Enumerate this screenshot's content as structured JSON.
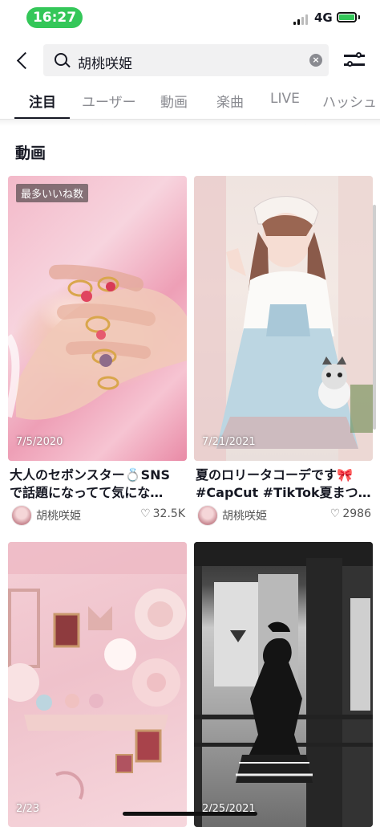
{
  "status_bar": {
    "time": "16:27",
    "network": "4G"
  },
  "search": {
    "query": "胡桃咲姫",
    "clear_label": "×"
  },
  "tabs": [
    {
      "label": "注目"
    },
    {
      "label": "ユーザー"
    },
    {
      "label": "動画"
    },
    {
      "label": "楽曲"
    },
    {
      "label": "LIVE"
    },
    {
      "label": "ハッシュ"
    }
  ],
  "active_tab": "注目",
  "section_title": "動画",
  "videos": [
    {
      "badge": "最多いいね数",
      "date": "7/5/2020",
      "caption_line1": "大人のセボンスター💍SNS",
      "caption_line2": "で話題になってて気にな…",
      "author": "胡桃咲姫",
      "likes": "32.5K"
    },
    {
      "badge": "",
      "date": "7/21/2021",
      "caption_line1": "夏のロリータコーデです🎀",
      "caption_line2": "#CapCut #TikTok夏まつり…",
      "author": "胡桃咲姫",
      "likes": "2986"
    },
    {
      "badge": "",
      "date": "2/23",
      "caption_line1": "",
      "caption_line2": "",
      "author": "",
      "likes": ""
    },
    {
      "badge": "",
      "date": "2/25/2021",
      "caption_line1": "",
      "caption_line2": "",
      "author": "",
      "likes": ""
    }
  ],
  "icons": {
    "back": "chevron-left-icon",
    "search": "search-icon",
    "clear": "clear-icon",
    "filter": "filter-sliders-icon",
    "heart": "heart-outline-icon"
  },
  "colors": {
    "status_pill": "#34c759",
    "text": "#161823",
    "muted": "#8a8b91"
  }
}
